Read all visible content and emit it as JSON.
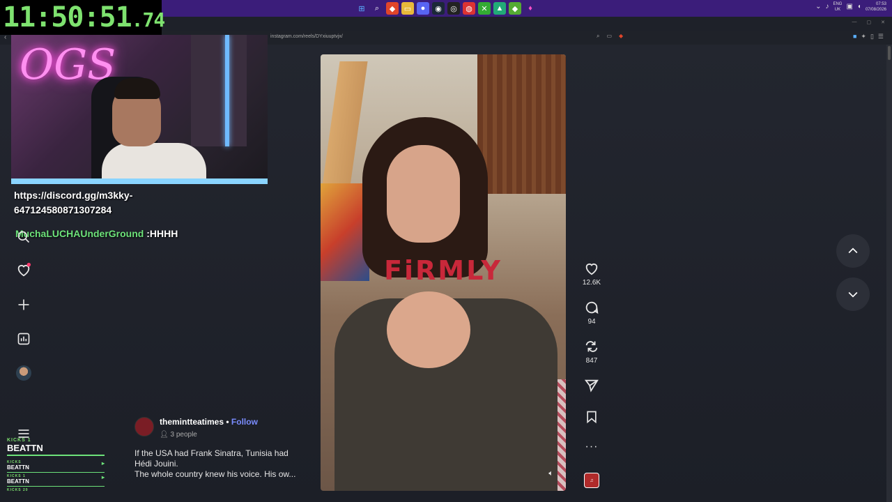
{
  "timer": {
    "main": "11:50:51",
    "fraction": ".74"
  },
  "browser": {
    "url": "instagram.com/reels/DYxiuuptvjx/"
  },
  "system_tray": {
    "lang_top": "ENG",
    "lang_bottom": "UK",
    "time": "07:53",
    "date": "07/08/2026"
  },
  "overlay": {
    "discord_line1": "https://discord.gg/m3kky-",
    "discord_line2": "647124580871307284",
    "chat_user": "MuchaLUCHAUnderGround",
    "chat_message": " :HHHH"
  },
  "kicks": {
    "label": "KICKS 1",
    "name": "BEATTN",
    "rows": [
      {
        "label": "KICKS",
        "name": "BEATTN"
      },
      {
        "label": "KICKS 1",
        "name": "BEATTN"
      }
    ],
    "footer": "KICKS 20"
  },
  "video": {
    "caption_overlay": "FiRMLY"
  },
  "actions": {
    "likes": "12.6K",
    "comments": "94",
    "reposts": "847"
  },
  "post": {
    "username": "themintteatimes",
    "separator": " • ",
    "follow_label": "Follow",
    "people": "3 people",
    "caption_line1": "If the USA had Frank Sinatra, Tunisia had",
    "caption_line2": "Hédi Jouini.",
    "caption_line3": "The whole country knew his voice. His ow..."
  },
  "colors": {
    "accent": "#7a8cff",
    "timer": "#7ee26f",
    "taskbar": "#3b1d7a"
  }
}
